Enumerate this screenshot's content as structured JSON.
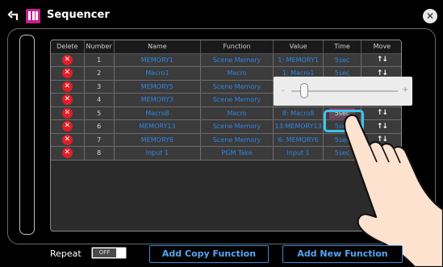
{
  "header": {
    "title": "Sequencer"
  },
  "table": {
    "columns": [
      "Delete",
      "Number",
      "Name",
      "Function",
      "Value",
      "Time",
      "Move"
    ],
    "rows": [
      {
        "number": "1",
        "name": "MEMORY1",
        "function": "Scene Memory",
        "value": "1: MEMORY1",
        "time": "5sec"
      },
      {
        "number": "2",
        "name": "Macro1",
        "function": "Macro",
        "value": "1: Macro1",
        "time": "5sec"
      },
      {
        "number": "3",
        "name": "MEMORY5",
        "function": "Scene Memory",
        "value": "5: MEMORY5",
        "time": "5sec"
      },
      {
        "number": "4",
        "name": "MEMORY3",
        "function": "Scene Memory",
        "value": "3: MEMORY3",
        "time": "5sec"
      },
      {
        "number": "5",
        "name": "Macro8",
        "function": "Macro",
        "value": "8: Macro8",
        "time": "5sec"
      },
      {
        "number": "6",
        "name": "MEMORY13",
        "function": "Scene Memory",
        "value": "13:MEMORY13",
        "time": "5sec"
      },
      {
        "number": "7",
        "name": "MEMORY6",
        "function": "Scene Memory",
        "value": "6: MEMORY6",
        "time": "5sec"
      },
      {
        "number": "8",
        "name": "Input 1",
        "function": "PGM Take",
        "value": "Input 1",
        "time": "5sec"
      }
    ],
    "delete_glyph": "✕",
    "move_glyph": "↑↓",
    "selected_row": 5
  },
  "slider": {
    "minus": "-",
    "plus": "+",
    "level": 0.12
  },
  "footer": {
    "repeat_label": "Repeat",
    "toggle_label": "OFF",
    "add_copy_label": "Add Copy Function",
    "add_new_label": "Add New Function"
  },
  "colors": {
    "accent_blue": "#2f84e4",
    "delete_red": "#e01e28",
    "focus_cyan": "#3dc4e8",
    "select_magenta": "#c21a86",
    "app_icon_magenta": "#c81e8c"
  },
  "icons": {
    "back": "back-arrow-icon",
    "app": "sequencer-app-icon",
    "close": "close-icon",
    "pointer": "hand-pointer-icon"
  }
}
